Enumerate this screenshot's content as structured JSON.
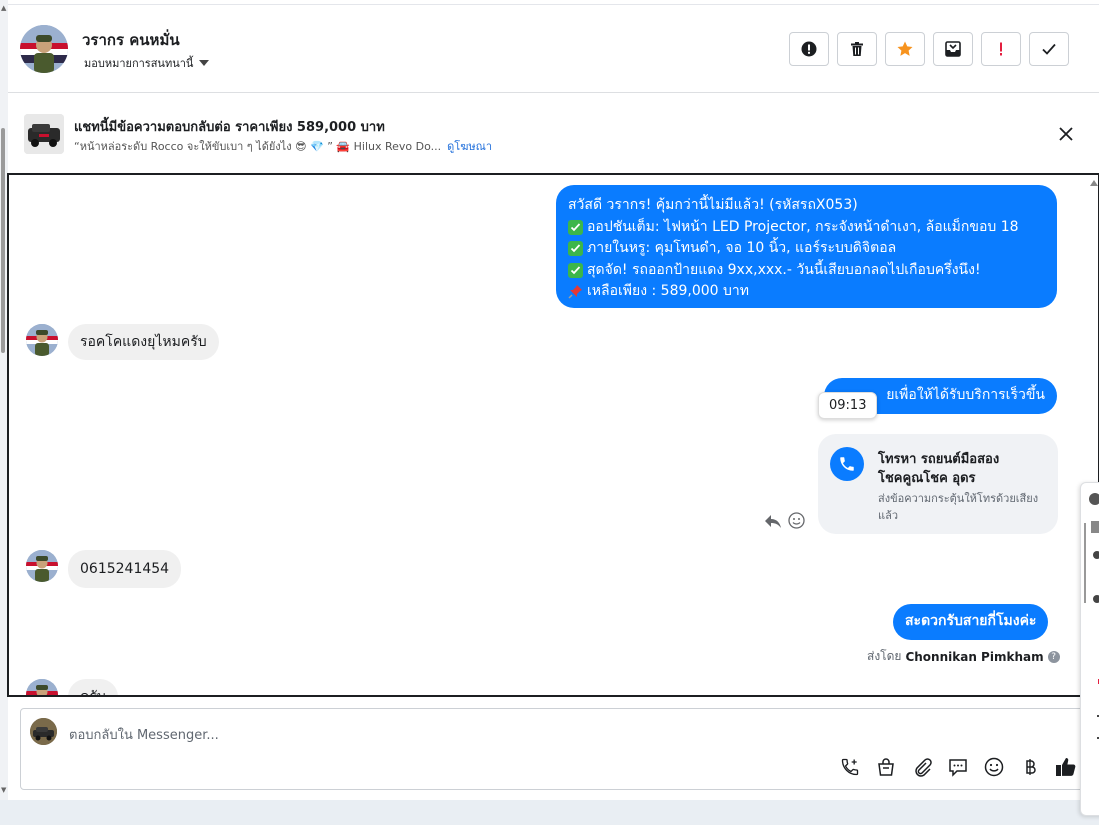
{
  "header": {
    "contact_name": "วรากร คนหมั่น",
    "assign_label": "มอบหมายการสนทนานี้",
    "actions": [
      "spam-report",
      "delete",
      "star",
      "move-to-inbox",
      "mark-important",
      "mark-done"
    ]
  },
  "ad_banner": {
    "title": "แชทนี้มีข้อความตอบกลับต่อ ราคาเพียง 589,000 บาท",
    "subtitle": "“หน้าหล่อระดับ Rocco จะให้ขับเบา ๆ ได้ยังไง 😎 💎 ” 🚘 Hilux Revo Do...",
    "link": "ดูโฆษณา"
  },
  "messages": {
    "m1_lines": [
      "สวัสดี วรากร! คุ้มกว่านี้ไม่มีแล้ว! (รหัสรถX053)",
      "ออปชันเต็ม: ไฟหน้า LED Projector, กระจังหน้าดำเงา, ล้อแม็กขอบ 18",
      "ภายในหรู: คุมโทนดำ, จอ 10 นิ้ว, แอร์ระบบดิจิตอล",
      "สุดจัด! รถออกป้ายแดง 9xx,xxx.- วันนี้เสียบอกลดไปเกือบครึ่งนึง!",
      "เหลือเพียง : 589,000 บาท"
    ],
    "m2": "รอคโคแดงยุไหมครับ",
    "m3_partial": "ยเพื่อให้ได้รับบริการเร็วขึ้น",
    "timestamp": "09:13",
    "call_card": {
      "title_line1": "โทรหา รถยนต์มือสอง",
      "title_line2": "โชคคูณโชค อุดร",
      "description": "ส่งข้อความกระตุ้นให้โทรด้วยเสียงแล้ว"
    },
    "m4": "0615241454",
    "m5": "สะดวกรับสายกี่โมงค่ะ",
    "sent_by_prefix": "ส่งโดย",
    "sent_by_name": "Chonnikan Pimkham",
    "m6_partial": "ครับ"
  },
  "composer": {
    "placeholder": "ตอบกลับใน Messenger..."
  },
  "colors": {
    "accent": "#0a7cff",
    "incoming_bubble": "#f0f0f0",
    "star": "#f7931e",
    "important": "#e41e3f"
  }
}
